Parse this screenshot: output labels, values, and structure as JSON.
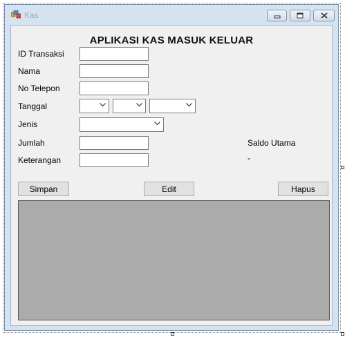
{
  "window": {
    "title": "Kas"
  },
  "form": {
    "header": "APLIKASI KAS MASUK KELUAR",
    "labels": {
      "id_transaksi": "ID Transaksi",
      "nama": "Nama",
      "no_telepon": "No Telepon",
      "tanggal": "Tanggal",
      "jenis": "Jenis",
      "jumlah": "Jumlah",
      "keterangan": "Keterangan"
    },
    "fields": {
      "id_transaksi": "",
      "nama": "",
      "no_telepon": "",
      "jumlah": "",
      "keterangan": ""
    },
    "saldo": {
      "label": "Saldo Utama",
      "value": "-"
    }
  },
  "buttons": {
    "simpan": "Simpan",
    "edit": "Edit",
    "hapus": "Hapus"
  },
  "icons": {
    "app": "app-window-icon",
    "minimize": "minimize-icon",
    "maximize": "maximize-icon",
    "close": "close-icon",
    "dropdown": "chevron-down-icon"
  }
}
